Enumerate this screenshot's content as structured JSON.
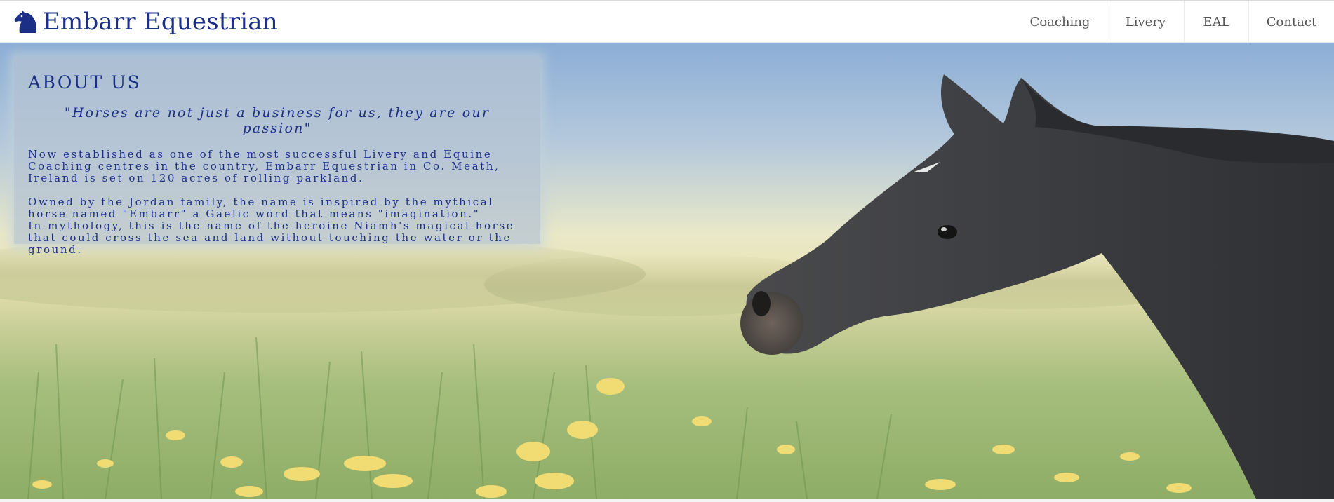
{
  "brand": {
    "name": "Embarr Equestrian",
    "logo_icon": "horse-head-icon",
    "color": "#1c2f86"
  },
  "nav": {
    "items": [
      {
        "label": "Coaching"
      },
      {
        "label": "Livery"
      },
      {
        "label": "EAL"
      },
      {
        "label": "Contact"
      }
    ]
  },
  "about": {
    "heading": "ABOUT US",
    "quote": "\"Horses are not just a business for us, they are our passion\"",
    "paragraph1": "Now established as one of the most successful Livery and Equine Coaching centres in the country, Embarr Equestrian in Co. Meath, Ireland is set on 120 acres of rolling parkland.",
    "paragraph2_line1": "Owned by the Jordan family, the name is inspired by the mythical horse named \"Embarr\" a Gaelic word that means \"imagination.\"",
    "paragraph2_line2": "In mythology, this is the name of the heroine Niamh's magical horse that could cross the sea and land without touching the water or the ground."
  },
  "hero": {
    "image": "horse-in-dandelion-meadow",
    "colors": {
      "sky_top": "#8fb0d6",
      "horizon": "#f1eec2",
      "grass": "#8fae6a",
      "horse": "#3b3c40",
      "flowers": "#f0dc72"
    }
  }
}
